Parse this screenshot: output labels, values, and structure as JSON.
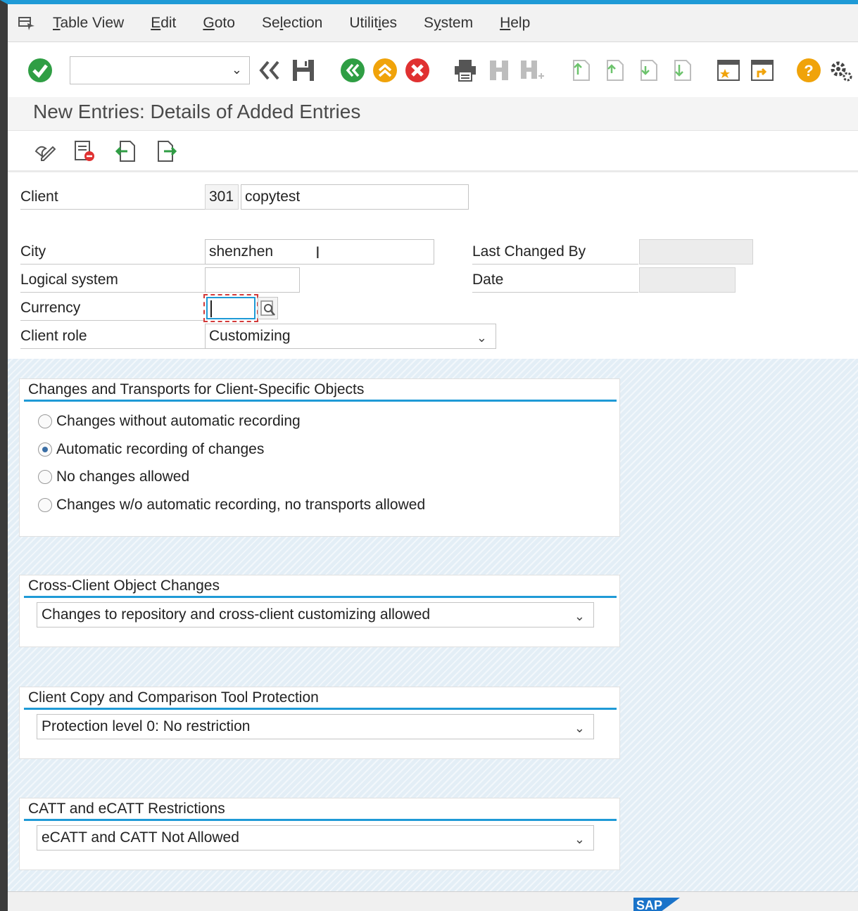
{
  "menu": {
    "items": [
      {
        "pre": "",
        "u": "T",
        "post": "able View"
      },
      {
        "pre": "",
        "u": "E",
        "post": "dit"
      },
      {
        "pre": "",
        "u": "G",
        "post": "oto"
      },
      {
        "pre": "Se",
        "u": "l",
        "post": "ection"
      },
      {
        "pre": "Utilit",
        "u": "i",
        "post": "es"
      },
      {
        "pre": "S",
        "u": "y",
        "post": "stem"
      },
      {
        "pre": "",
        "u": "H",
        "post": "elp"
      }
    ]
  },
  "toolbar": {
    "command_field_value": "",
    "icons": [
      "enter-icon",
      "back-arrows-icon",
      "save-icon",
      "back-icon",
      "exit-icon",
      "cancel-icon",
      "print-icon",
      "find-icon",
      "find-next-icon",
      "first-page-icon",
      "previous-page-icon",
      "next-page-icon",
      "last-page-icon",
      "new-session-icon",
      "shortcut-icon",
      "help-icon",
      "settings-icon"
    ]
  },
  "page": {
    "title": "New Entries: Details of Added Entries"
  },
  "form": {
    "client_label": "Client",
    "client_number": "301",
    "client_name": "copytest",
    "city_label": "City",
    "city_value": "shenzhen",
    "logical_system_label": "Logical system",
    "logical_system_value": "",
    "currency_label": "Currency",
    "currency_value": "",
    "client_role_label": "Client role",
    "client_role_value": "Customizing",
    "last_changed_by_label": "Last Changed By",
    "last_changed_by_value": "",
    "date_label": "Date",
    "date_value": ""
  },
  "groups": {
    "changes_transports": {
      "title": "Changes and Transports for Client-Specific Objects",
      "options": [
        {
          "label": "Changes without automatic recording",
          "selected": false
        },
        {
          "label": "Automatic recording of changes",
          "selected": true
        },
        {
          "label": "No changes allowed",
          "selected": false
        },
        {
          "label": "Changes w/o automatic recording, no transports allowed",
          "selected": false
        }
      ]
    },
    "cross_client": {
      "title": "Cross-Client Object Changes",
      "value": "Changes to repository and cross-client customizing allowed"
    },
    "client_copy": {
      "title": "Client Copy and Comparison Tool Protection",
      "value": "Protection level 0: No restriction"
    },
    "catt": {
      "title": "CATT and eCATT Restrictions",
      "value": "eCATT and CATT Not Allowed"
    }
  },
  "status": {
    "logo": "SAP"
  }
}
